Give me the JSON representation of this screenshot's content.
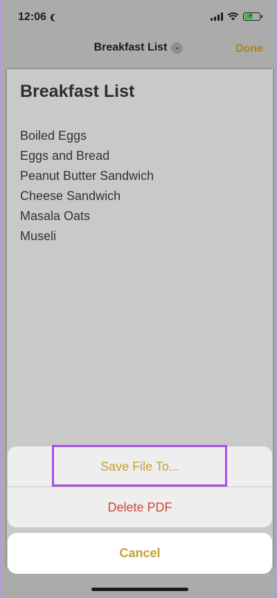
{
  "status_bar": {
    "time": "12:06"
  },
  "nav": {
    "title": "Breakfast List",
    "done_label": "Done"
  },
  "document": {
    "title": "Breakfast List",
    "items": [
      "Boiled Eggs",
      "Eggs and Bread",
      "Peanut Butter Sandwich",
      "Cheese Sandwich",
      "Masala Oats",
      "Museli"
    ]
  },
  "action_sheet": {
    "save_label": "Save File To...",
    "delete_label": "Delete PDF",
    "cancel_label": "Cancel"
  },
  "colors": {
    "accent": "#c9a030",
    "destructive": "#d2463a",
    "highlight": "#a64ee8"
  }
}
